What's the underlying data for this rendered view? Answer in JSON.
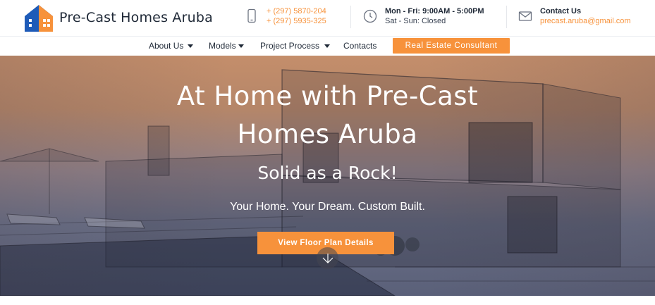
{
  "brand": {
    "name": "Pre-Cast Homes Aruba",
    "logo_icon": "house-logo-icon",
    "colors": {
      "accent": "#f7923b",
      "logo_blue": "#1e5bb8",
      "logo_orange": "#f7923b"
    }
  },
  "header": {
    "phone": {
      "icon": "phone-icon",
      "line1": "+ (297) 5870-204",
      "line2": "+ (297) 5935-325"
    },
    "hours": {
      "icon": "clock-icon",
      "line1": "Mon - Fri: 9:00AM - 5:00PM",
      "line2": "Sat - Sun: Closed"
    },
    "contact": {
      "icon": "mail-icon",
      "title": "Contact Us",
      "email": "precast.aruba@gmail.com"
    }
  },
  "nav": {
    "items": [
      {
        "label": "About Us",
        "dropdown": true
      },
      {
        "label": "Models",
        "dropdown": true
      },
      {
        "label": "Project Process",
        "dropdown": true
      },
      {
        "label": "Contacts",
        "dropdown": false
      }
    ],
    "cta": "Real Estate Consultant"
  },
  "hero": {
    "title_line1": "At Home with Pre-Cast",
    "title_line2": "Homes Aruba",
    "subtitle": "Solid as a Rock!",
    "tagline": "Your Home. Your Dream. Custom Built.",
    "button": "View Floor Plan Details",
    "scroll_icon": "arrow-down-icon"
  }
}
